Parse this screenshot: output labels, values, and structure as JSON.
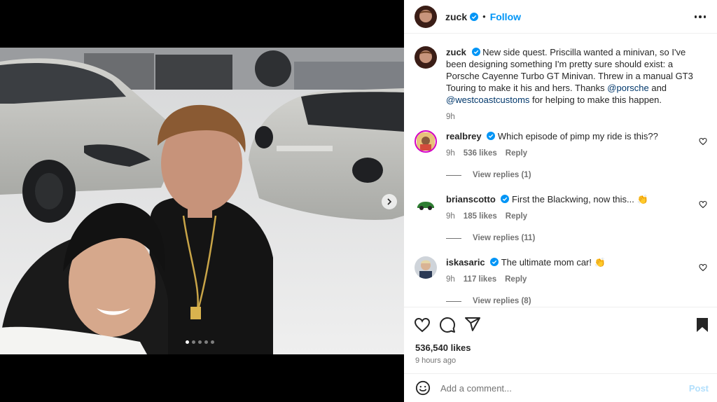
{
  "post": {
    "author": "zuck",
    "follow_label": "Follow",
    "separator": "•",
    "caption_text": "New side quest. Priscilla wanted a minivan, so I've been designing something I'm pretty sure should exist: a Porsche Cayenne Turbo GT Minivan. Threw in a manual GT3 Touring to make it his and hers. Thanks ",
    "mention_1": "@porsche",
    "caption_and": " and ",
    "mention_2": "@westcoastcustoms",
    "caption_end": " for helping to make this happen.",
    "caption_time": "9h",
    "likes": "536,540 likes",
    "time_ago": "9 hours ago"
  },
  "carousel": {
    "slide_count": 5,
    "active_index": 0
  },
  "comments": [
    {
      "username": "realbrey",
      "text": "Which episode of pimp my ride is this??",
      "time": "9h",
      "likes": "536 likes",
      "reply": "Reply",
      "view_replies": "View replies (1)"
    },
    {
      "username": "brianscotto",
      "text": "First the Blackwing, now this...",
      "emoji": "👏",
      "time": "9h",
      "likes": "185 likes",
      "reply": "Reply",
      "view_replies": "View replies (11)"
    },
    {
      "username": "iskasaric",
      "text": "The ultimate mom car!",
      "emoji": "👏",
      "time": "9h",
      "likes": "117 likes",
      "reply": "Reply",
      "view_replies": "View replies (8)"
    }
  ],
  "add_comment": {
    "placeholder": "Add a comment...",
    "post_label": "Post"
  },
  "icons": {
    "verified": "verified-badge-icon",
    "more": "more-options-icon",
    "heart": "heart-icon",
    "comment": "comment-icon",
    "share": "share-icon",
    "save": "bookmark-icon",
    "emoji": "emoji-icon",
    "next": "chevron-right-icon"
  },
  "colors": {
    "accent": "#0095f6",
    "mention": "#00376b",
    "muted": "#737373",
    "verified": "#0095f6"
  }
}
